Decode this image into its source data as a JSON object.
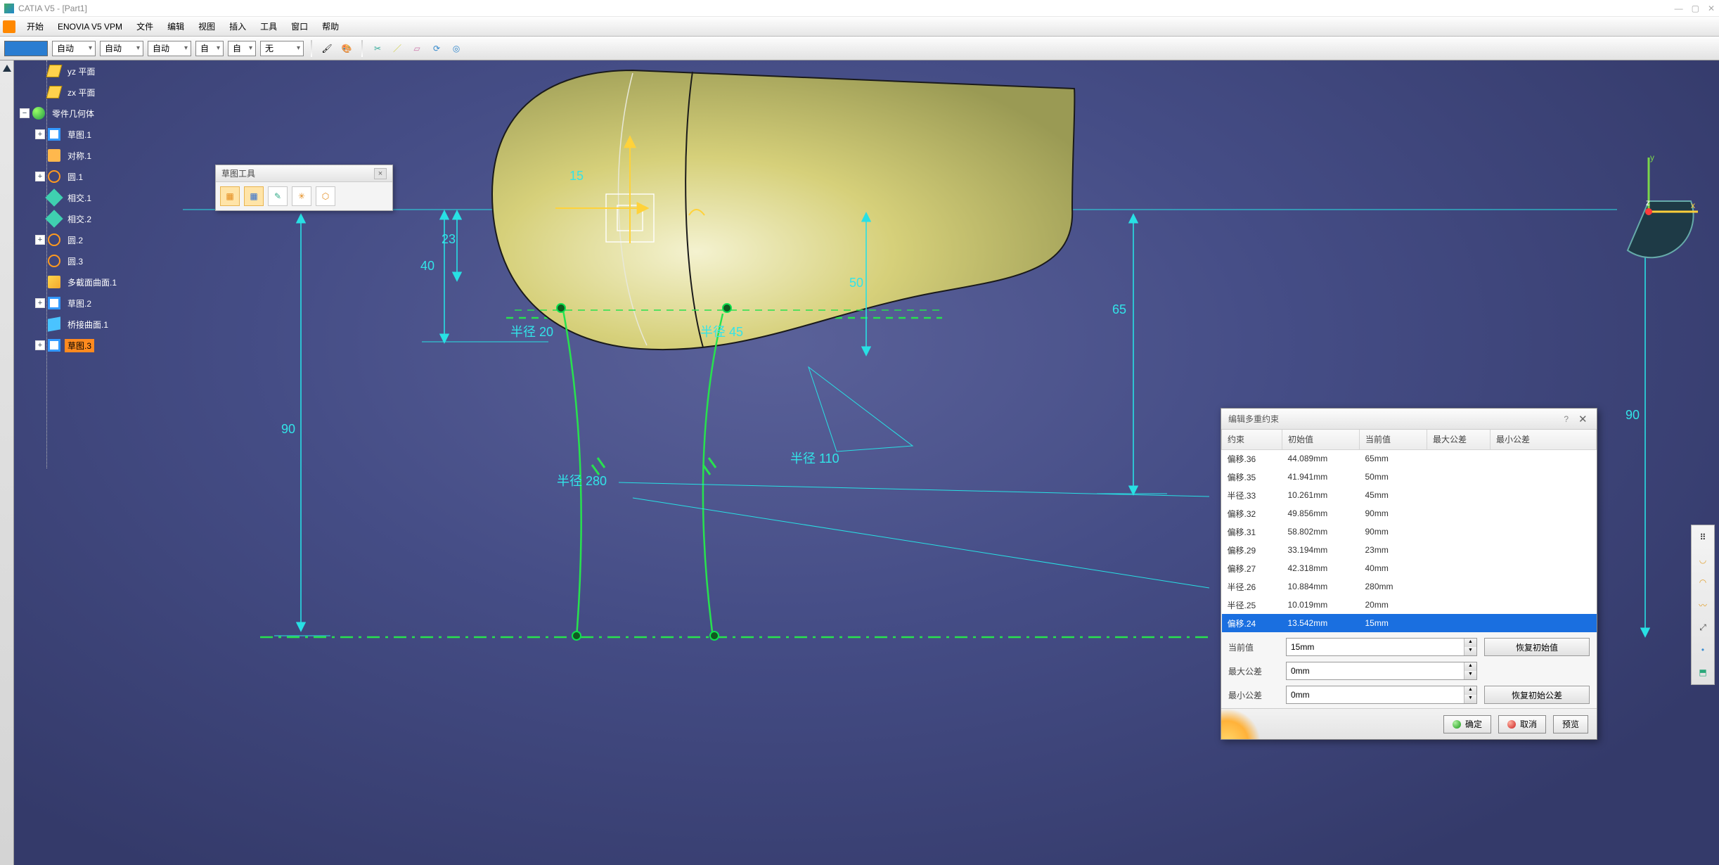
{
  "title": "CATIA V5 - [Part1]",
  "menu": [
    "开始",
    "ENOVIA V5 VPM",
    "文件",
    "编辑",
    "视图",
    "插入",
    "工具",
    "窗口",
    "帮助"
  ],
  "toolbar": {
    "selects": [
      "自动",
      "自动",
      "自动",
      "自",
      "自",
      "无"
    ]
  },
  "tree": [
    {
      "lvl": 2,
      "exp": " ",
      "icon": "ic-plane",
      "label": "yz 平面"
    },
    {
      "lvl": 2,
      "exp": " ",
      "icon": "ic-plane",
      "label": "zx 平面"
    },
    {
      "lvl": 1,
      "exp": "−",
      "icon": "ic-body",
      "label": "零件几何体"
    },
    {
      "lvl": 2,
      "exp": "+",
      "icon": "ic-sketch",
      "label": "草图.1"
    },
    {
      "lvl": 2,
      "exp": " ",
      "icon": "ic-sym",
      "label": "对称.1"
    },
    {
      "lvl": 2,
      "exp": "+",
      "icon": "ic-circle",
      "label": "圆.1"
    },
    {
      "lvl": 2,
      "exp": " ",
      "icon": "ic-int",
      "label": "相交.1"
    },
    {
      "lvl": 2,
      "exp": " ",
      "icon": "ic-int",
      "label": "相交.2"
    },
    {
      "lvl": 2,
      "exp": "+",
      "icon": "ic-circle",
      "label": "圆.2"
    },
    {
      "lvl": 2,
      "exp": " ",
      "icon": "ic-circle",
      "label": "圆.3"
    },
    {
      "lvl": 2,
      "exp": " ",
      "icon": "ic-surf",
      "label": "多截面曲面.1"
    },
    {
      "lvl": 2,
      "exp": "+",
      "icon": "ic-sketch",
      "label": "草图.2"
    },
    {
      "lvl": 2,
      "exp": " ",
      "icon": "ic-bridge",
      "label": "桥接曲面.1"
    },
    {
      "lvl": 2,
      "exp": "+",
      "icon": "ic-sketch",
      "label": "草图.3",
      "sel": true
    }
  ],
  "sketchTools": {
    "title": "草图工具"
  },
  "dims": {
    "d90": "90",
    "d40": "40",
    "d23": "23",
    "d15": "15",
    "d50": "50",
    "d65": "65",
    "d90r": "90",
    "r20": "半径 20",
    "r45": "半径 45",
    "r280": "半径 280",
    "r110": "半径 110"
  },
  "triad": {
    "x": "x",
    "y": "y",
    "z": "z"
  },
  "dialog": {
    "title": "编辑多重约束",
    "cols": [
      "约束",
      "初始值",
      "当前值",
      "最大公差",
      "最小公差"
    ],
    "rows": [
      {
        "c": "偏移.36",
        "i": "44.089mm",
        "v": "65mm"
      },
      {
        "c": "偏移.35",
        "i": "41.941mm",
        "v": "50mm"
      },
      {
        "c": "半径.33",
        "i": "10.261mm",
        "v": "45mm"
      },
      {
        "c": "偏移.32",
        "i": "49.856mm",
        "v": "90mm"
      },
      {
        "c": "偏移.31",
        "i": "58.802mm",
        "v": "90mm"
      },
      {
        "c": "偏移.29",
        "i": "33.194mm",
        "v": "23mm"
      },
      {
        "c": "偏移.27",
        "i": "42.318mm",
        "v": "40mm"
      },
      {
        "c": "半径.26",
        "i": "10.884mm",
        "v": "280mm"
      },
      {
        "c": "半径.25",
        "i": "10.019mm",
        "v": "20mm"
      },
      {
        "c": "偏移.24",
        "i": "13.542mm",
        "v": "15mm",
        "sel": true
      }
    ],
    "form": {
      "curLabel": "当前值",
      "curVal": "15mm",
      "maxLabel": "最大公差",
      "maxVal": "0mm",
      "minLabel": "最小公差",
      "minVal": "0mm",
      "restoreVal": "恢复初始值",
      "restoreTol": "恢复初始公差"
    },
    "buttons": {
      "ok": "确定",
      "cancel": "取消",
      "preview": "预览"
    }
  }
}
